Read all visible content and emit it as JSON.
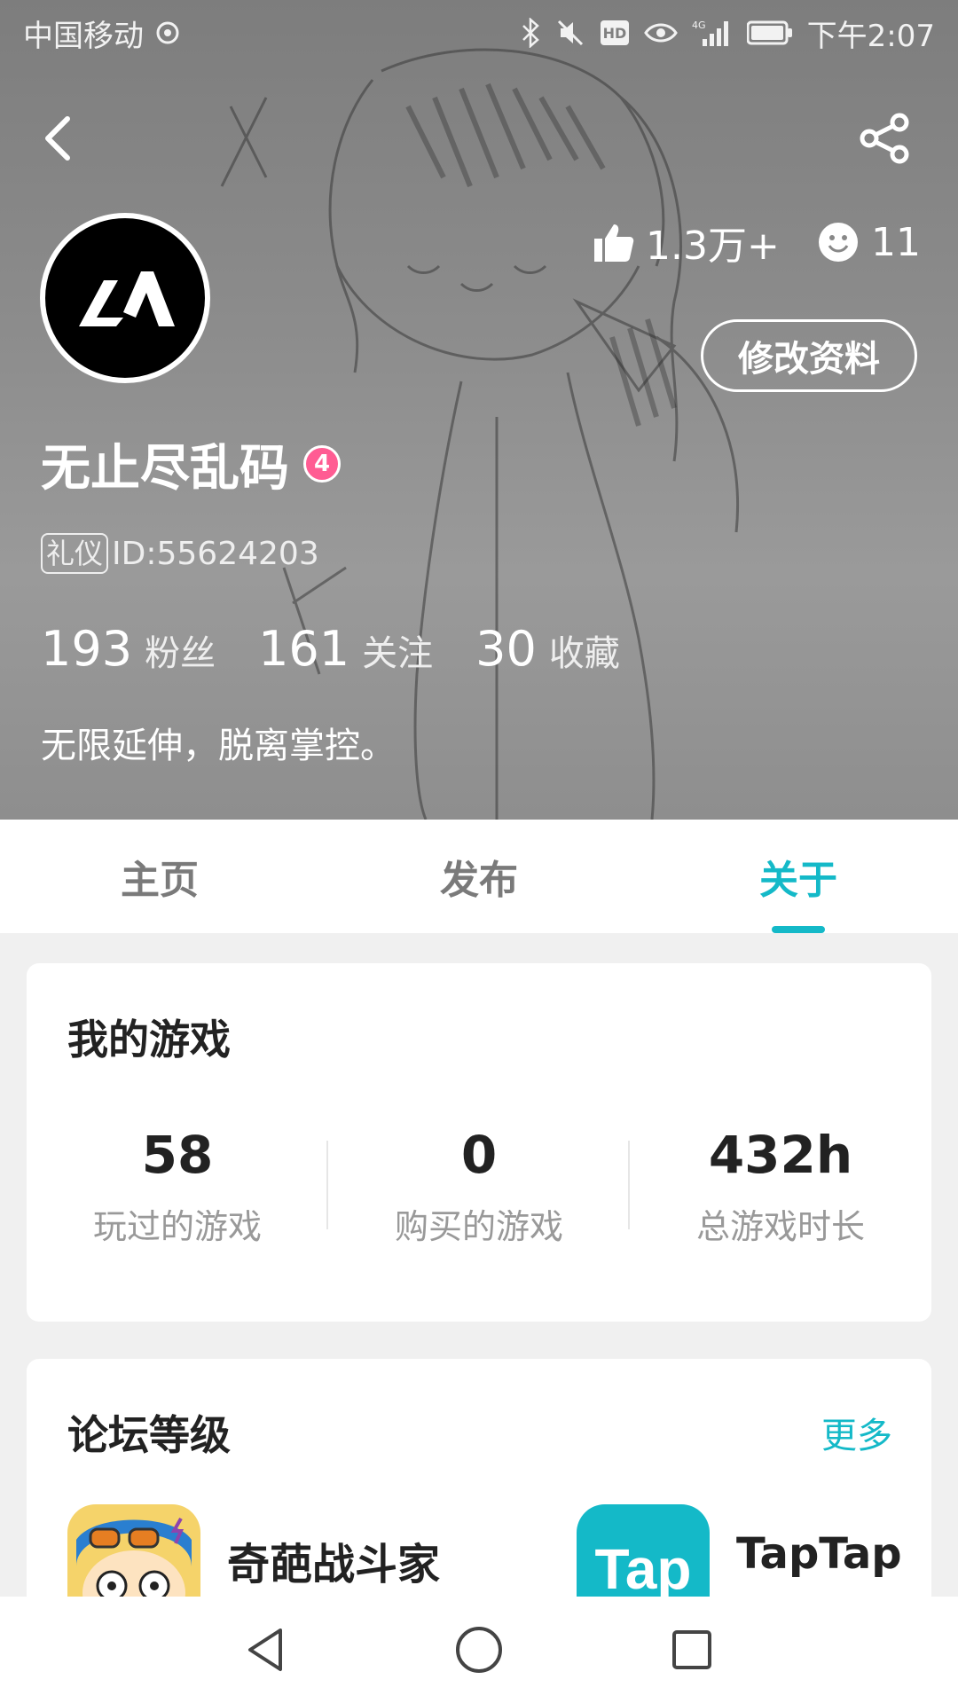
{
  "status_bar": {
    "carrier": "中国移动",
    "time": "下午2:07",
    "hd_label": "HD",
    "network_label": "4G"
  },
  "profile": {
    "likes": "1.3万+",
    "face_count": "11",
    "edit_button": "修改资料",
    "username": "无止尽乱码",
    "level": "4",
    "tag": "礼仪",
    "id_text": "ID:55624203",
    "stats": [
      {
        "num": "193",
        "label": "粉丝"
      },
      {
        "num": "161",
        "label": "关注"
      },
      {
        "num": "30",
        "label": "收藏"
      }
    ],
    "bio": "无限延伸，脱离掌控。"
  },
  "tabs": [
    {
      "label": "主页",
      "active": false
    },
    {
      "label": "发布",
      "active": false
    },
    {
      "label": "关于",
      "active": true
    }
  ],
  "my_games": {
    "title": "我的游戏",
    "stats": [
      {
        "value": "58",
        "label": "玩过的游戏"
      },
      {
        "value": "0",
        "label": "购买的游戏"
      },
      {
        "value": "432h",
        "label": "总游戏时长"
      }
    ]
  },
  "forum_level": {
    "title": "论坛等级",
    "more": "更多",
    "items": [
      {
        "name": "奇葩战斗家",
        "icon": "game-character-icon"
      },
      {
        "name": "TapTap",
        "icon": "taptap-icon",
        "icon_text": "Tap"
      }
    ]
  },
  "colors": {
    "accent": "#14b9c8",
    "level_badge": "#ff5c93"
  },
  "nav": [
    "back-triangle-icon",
    "home-circle-icon",
    "recents-square-icon"
  ]
}
